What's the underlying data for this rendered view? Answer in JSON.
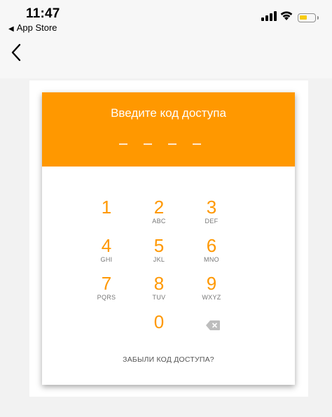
{
  "status_bar": {
    "time": "11:47",
    "back_app": "App Store",
    "battery_color": "#f7cb12"
  },
  "nav": {
    "back_icon": "chevron-left-icon"
  },
  "lock_screen": {
    "accent_color": "#ff9800",
    "title": "Введите код доступа",
    "pin_length": 4,
    "keys": [
      {
        "digit": "1",
        "letters": ""
      },
      {
        "digit": "2",
        "letters": "ABC"
      },
      {
        "digit": "3",
        "letters": "DEF"
      },
      {
        "digit": "4",
        "letters": "GHI"
      },
      {
        "digit": "5",
        "letters": "JKL"
      },
      {
        "digit": "6",
        "letters": "MNO"
      },
      {
        "digit": "7",
        "letters": "PQRS"
      },
      {
        "digit": "8",
        "letters": "TUV"
      },
      {
        "digit": "9",
        "letters": "WXYZ"
      },
      {
        "digit": "0",
        "letters": ""
      }
    ],
    "backspace_icon": "backspace-icon",
    "forgot_label": "ЗАБЫЛИ КОД ДОСТУПА?"
  }
}
